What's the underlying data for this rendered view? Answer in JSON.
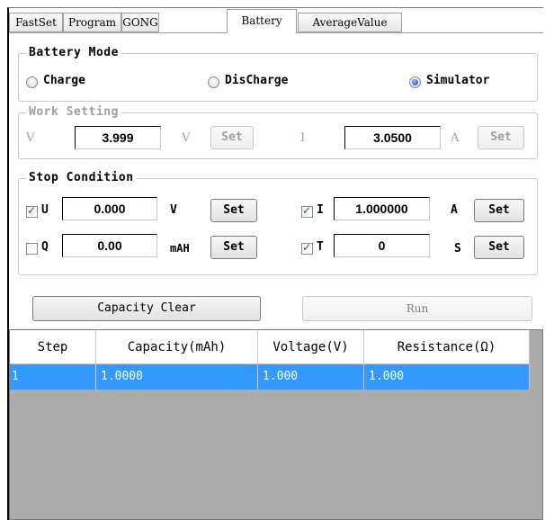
{
  "tabs": [
    {
      "label": "FastSet"
    },
    {
      "label": "Program"
    },
    {
      "label": "GONG"
    },
    {
      "label": "Battery",
      "active": true
    },
    {
      "label": "AverageValue"
    }
  ],
  "battery_mode": {
    "title": "Battery Mode",
    "options": [
      {
        "label": "Charge",
        "selected": false
      },
      {
        "label": "DisCharge",
        "selected": false
      },
      {
        "label": "Simulator",
        "selected": true
      }
    ]
  },
  "work_setting": {
    "title": "Work Setting",
    "v_label": "V",
    "v_value": "3.999",
    "v_unit": "V",
    "v_set": "Set",
    "i_label": "I",
    "i_value": "3.0500",
    "i_unit": "A",
    "i_set": "Set"
  },
  "stop_condition": {
    "title": "Stop Condition",
    "u": {
      "label": "U",
      "checked": true,
      "value": "0.000",
      "unit": "V",
      "set": "Set"
    },
    "i": {
      "label": "I",
      "checked": true,
      "value": "1.000000",
      "unit": "A",
      "set": "Set"
    },
    "q": {
      "label": "Q",
      "checked": false,
      "value": "0.00",
      "unit": "mAH",
      "set": "Set"
    },
    "t": {
      "label": "T",
      "checked": true,
      "value": "0",
      "unit": "S",
      "set": "Set"
    }
  },
  "actions": {
    "capacity_clear": "Capacity Clear",
    "run": "Run"
  },
  "table": {
    "columns": [
      "Step",
      "Capacity(mAh)",
      "Voltage(V)",
      "Resistance(Ω)"
    ],
    "rows": [
      [
        "1",
        "1.0000",
        "1.000",
        "1.000"
      ]
    ]
  },
  "colors": {
    "selection": "#3399ff",
    "grid_background": "#ababab"
  }
}
